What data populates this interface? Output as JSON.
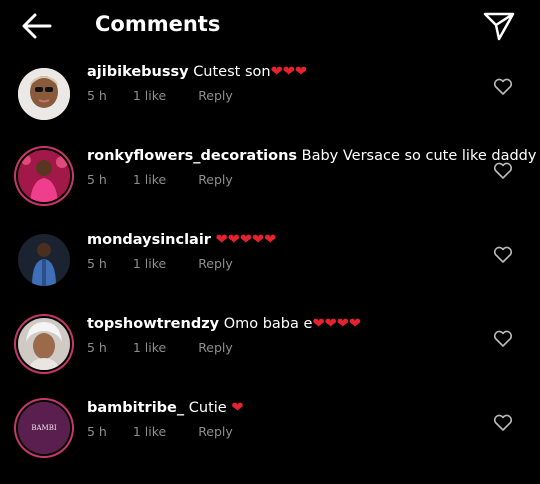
{
  "header": {
    "title": "Comments",
    "back_icon": "arrow-left-icon",
    "send_icon": "send-icon"
  },
  "comments": [
    {
      "username": "ajibikebussy",
      "text": "Cutest son",
      "emoji": "❤❤❤",
      "time": "5 h",
      "likes": "1 like",
      "reply": "Reply"
    },
    {
      "username": "ronkyflowers_decorations",
      "text": "Baby Versace so cute like daddy",
      "emoji": "",
      "time": "5 h",
      "likes": "1 like",
      "reply": "Reply"
    },
    {
      "username": "mondaysinclair",
      "text": "",
      "emoji": "❤❤❤❤❤",
      "time": "5 h",
      "likes": "1 like",
      "reply": "Reply"
    },
    {
      "username": "topshowtrendzy",
      "text": "Omo baba e",
      "emoji": "❤❤❤❤",
      "time": "5 h",
      "likes": "1 like",
      "reply": "Reply"
    },
    {
      "username": "bambitribe_",
      "text": "Cutie",
      "emoji": "❤",
      "time": "5 h",
      "likes": "1 like",
      "reply": "Reply"
    }
  ],
  "avatars": {
    "bambitribe_": {
      "logo_text": "BAMBI"
    }
  },
  "colors": {
    "background": "#000000",
    "meta_text": "#8e8e8e",
    "heart_red": "#e8212f",
    "story_ring": "#c7376b"
  }
}
